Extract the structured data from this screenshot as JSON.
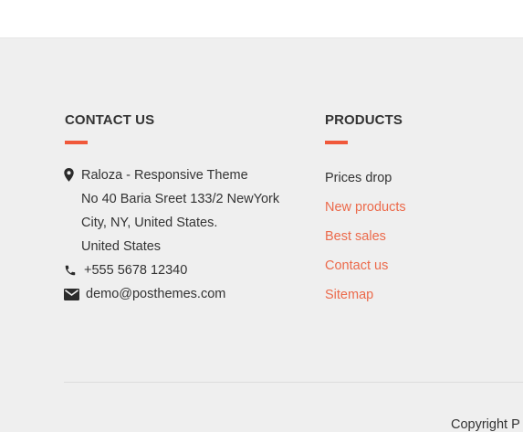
{
  "colors": {
    "accent": "#f0583a",
    "link": "#ec6a4b",
    "text": "#333333",
    "background": "#efefef"
  },
  "contact": {
    "title": "CONTACT US",
    "address_lines": [
      "Raloza - Responsive Theme",
      "No 40 Baria Sreet 133/2 NewYork",
      "City, NY, United States.",
      "United States"
    ],
    "phone": "+555 5678 12340",
    "email": "demo@posthemes.com",
    "icons": {
      "address": "map-pin-icon",
      "phone": "phone-icon",
      "email": "envelope-icon"
    }
  },
  "products": {
    "title": "PRODUCTS",
    "links": [
      {
        "label": "Prices drop",
        "highlighted": false
      },
      {
        "label": "New products",
        "highlighted": true
      },
      {
        "label": "Best sales",
        "highlighted": true
      },
      {
        "label": "Contact us",
        "highlighted": true
      },
      {
        "label": "Sitemap",
        "highlighted": true
      }
    ]
  },
  "copyright": {
    "text": "Copyright P"
  }
}
